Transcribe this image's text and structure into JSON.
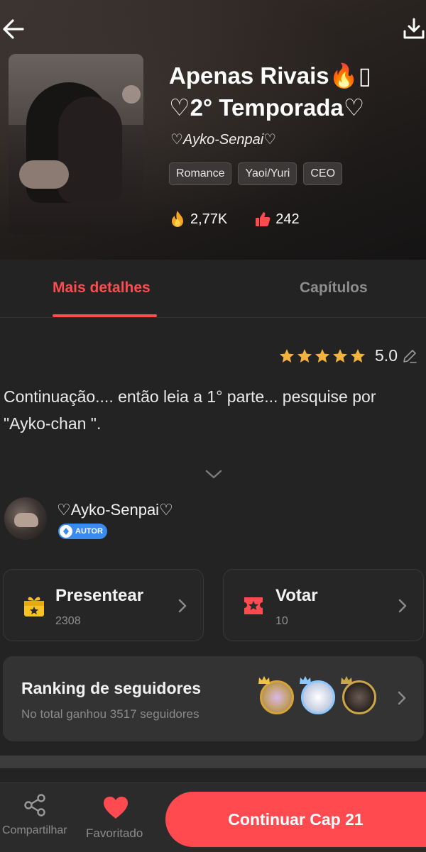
{
  "header": {
    "back_icon": "arrow-left-icon",
    "download_icon": "download-icon"
  },
  "book": {
    "title": "Apenas Rivais🔥\u0000 ♡2° Temporada♡",
    "title_line1": "Apenas Rivais🔥▯",
    "title_line2": "♡2° Temporada♡",
    "author": "♡Ayko-Senpai♡",
    "tags": [
      "Romance",
      "Yaoi/Yuri",
      "CEO"
    ],
    "views": "2,77K",
    "likes": "242"
  },
  "tabs": {
    "details": "Mais detalhes",
    "chapters": "Capítulos"
  },
  "rating": {
    "stars": 5,
    "value": "5.0"
  },
  "description": "Continuação.... então leia a 1° parte... pesquise por \"Ayko-chan \".",
  "author_section": {
    "name": "♡Ayko-Senpai♡",
    "badge": "AUTOR"
  },
  "gift_card": {
    "title": "Presentear",
    "count": "2308"
  },
  "vote_card": {
    "title": "Votar",
    "count": "10"
  },
  "ranking": {
    "title": "Ranking de seguidores",
    "subtitle": "No total ganhou 3517 seguidores"
  },
  "bottom_bar": {
    "share_label": "Compartilhar",
    "favorite_label": "Favoritado",
    "continue_label": "Continuar Cap 21"
  },
  "colors": {
    "accent": "#ff4a4f",
    "background": "#232323",
    "star": "#f2b33d",
    "badge_blue": "#3a8bef"
  }
}
